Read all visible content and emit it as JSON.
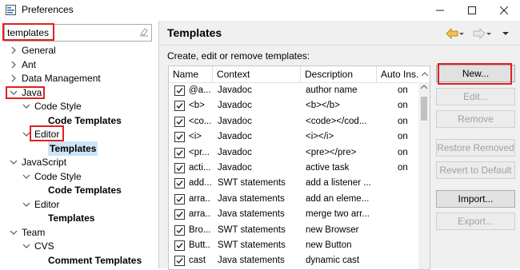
{
  "window": {
    "title": "Preferences"
  },
  "filter": {
    "value": "templates"
  },
  "tree": [
    {
      "label": "General",
      "level": 0,
      "expand": "collapsed",
      "bold": false
    },
    {
      "label": "Ant",
      "level": 0,
      "expand": "collapsed",
      "bold": false
    },
    {
      "label": "Data Management",
      "level": 0,
      "expand": "collapsed",
      "bold": false
    },
    {
      "label": "Java",
      "level": 0,
      "expand": "expanded",
      "bold": false
    },
    {
      "label": "Code Style",
      "level": 1,
      "expand": "expanded",
      "bold": false
    },
    {
      "label": "Code Templates",
      "level": 2,
      "expand": "none",
      "bold": true
    },
    {
      "label": "Editor",
      "level": 1,
      "expand": "expanded",
      "bold": false
    },
    {
      "label": "Templates",
      "level": 2,
      "expand": "none",
      "bold": true,
      "selected": true
    },
    {
      "label": "JavaScript",
      "level": 0,
      "expand": "expanded",
      "bold": false
    },
    {
      "label": "Code Style",
      "level": 1,
      "expand": "expanded",
      "bold": false
    },
    {
      "label": "Code Templates",
      "level": 2,
      "expand": "none",
      "bold": true
    },
    {
      "label": "Editor",
      "level": 1,
      "expand": "expanded",
      "bold": false
    },
    {
      "label": "Templates",
      "level": 2,
      "expand": "none",
      "bold": true
    },
    {
      "label": "Team",
      "level": 0,
      "expand": "expanded",
      "bold": false
    },
    {
      "label": "CVS",
      "level": 1,
      "expand": "expanded",
      "bold": false
    },
    {
      "label": "Comment Templates",
      "level": 2,
      "expand": "none",
      "bold": true
    }
  ],
  "page": {
    "title": "Templates",
    "subtitle": "Create, edit or remove templates:"
  },
  "table": {
    "columns": [
      "Name",
      "Context",
      "Description",
      "Auto Ins."
    ],
    "rows": [
      {
        "name": "@a...",
        "context": "Javadoc",
        "description": "author name",
        "auto": "on"
      },
      {
        "name": "<b>",
        "context": "Javadoc",
        "description": "<b></b>",
        "auto": "on"
      },
      {
        "name": "<co...",
        "context": "Javadoc",
        "description": "<code></cod...",
        "auto": "on"
      },
      {
        "name": "<i>",
        "context": "Javadoc",
        "description": "<i></i>",
        "auto": "on"
      },
      {
        "name": "<pr...",
        "context": "Javadoc",
        "description": "<pre></pre>",
        "auto": "on"
      },
      {
        "name": "acti...",
        "context": "Javadoc",
        "description": "active task",
        "auto": "on"
      },
      {
        "name": "add...",
        "context": "SWT statements",
        "description": "add a listener ...",
        "auto": ""
      },
      {
        "name": "arra...",
        "context": "Java statements",
        "description": "add an eleme...",
        "auto": ""
      },
      {
        "name": "arra...",
        "context": "Java statements",
        "description": "merge two arr...",
        "auto": ""
      },
      {
        "name": "Bro...",
        "context": "SWT statements",
        "description": "new Browser",
        "auto": ""
      },
      {
        "name": "Butt...",
        "context": "SWT statements",
        "description": "new Button",
        "auto": ""
      },
      {
        "name": "cast",
        "context": "Java statements",
        "description": "dynamic cast",
        "auto": ""
      }
    ]
  },
  "buttons": {
    "new": "New...",
    "edit": "Edit...",
    "remove": "Remove",
    "restore_removed": "Restore Removed",
    "revert_default": "Revert to Default",
    "import": "Import...",
    "export": "Export..."
  },
  "icons": {
    "app": "preferences-icon",
    "minimize": "minimize-icon",
    "maximize": "maximize-icon",
    "close": "close-icon",
    "back": "back-arrow-icon",
    "forward": "forward-arrow-icon",
    "menu": "view-menu-icon"
  },
  "colors": {
    "highlight": "#e02020",
    "selection": "#cce4f7",
    "nav_arrow": "#e8a030"
  }
}
